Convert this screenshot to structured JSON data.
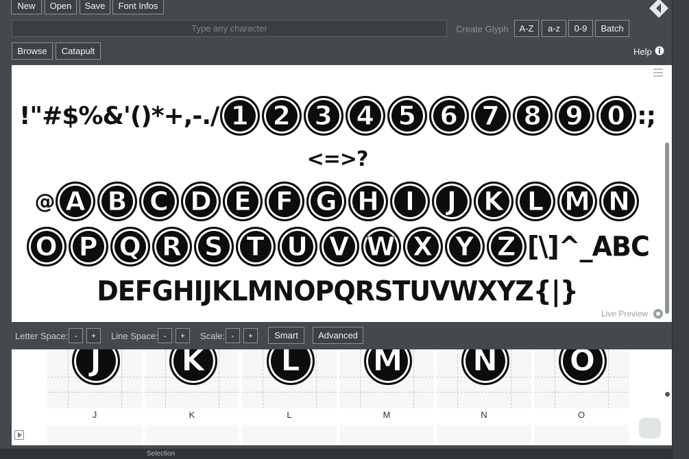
{
  "toolbar": {
    "new": "New",
    "open": "Open",
    "save": "Save",
    "font_infos": "Font Infos"
  },
  "glyph_bar": {
    "placeholder": "Type any character",
    "create_glyph": "Create Glyph",
    "az_upper": "A-Z",
    "az_lower": "a-z",
    "digits": "0-9",
    "batch": "Batch"
  },
  "nav": {
    "browse": "Browse",
    "catapult": "Catapult",
    "help": "Help"
  },
  "preview": {
    "line1_punct": "!\"#$%&'()*+,-./",
    "line1_digits": [
      "1",
      "2",
      "3",
      "4",
      "5",
      "6",
      "7",
      "8",
      "9",
      "0"
    ],
    "line1_tail": ":;",
    "line2": "<=>?",
    "line3_lead": "@",
    "line3_letters": [
      "A",
      "B",
      "C",
      "D",
      "E",
      "F",
      "G",
      "H",
      "I",
      "J",
      "K",
      "L",
      "M",
      "N"
    ],
    "line4_letters": [
      "O",
      "P",
      "Q",
      "R",
      "S",
      "T",
      "U",
      "V",
      "W",
      "X",
      "Y",
      "Z"
    ],
    "line4_tail": "[\\]^_ABC",
    "line5": "DEFGHIJKLMNOPQRSTUVWXYZ{|}",
    "live_preview": "Live Preview"
  },
  "spacing": {
    "letter_space": "Letter Space:",
    "line_space": "Line Space:",
    "scale": "Scale:",
    "minus": "-",
    "plus": "+",
    "smart": "Smart",
    "advanced": "Advanced"
  },
  "glyph_grid": {
    "cells": [
      "J",
      "K",
      "L",
      "M",
      "N",
      "O"
    ]
  },
  "status_bar": {
    "selection": "Selection"
  },
  "colors": {
    "background": "#444a4c",
    "button_border": "#8e9496",
    "preview_bg": "#ffffff",
    "glyph_fill": "#0d0d0d"
  }
}
